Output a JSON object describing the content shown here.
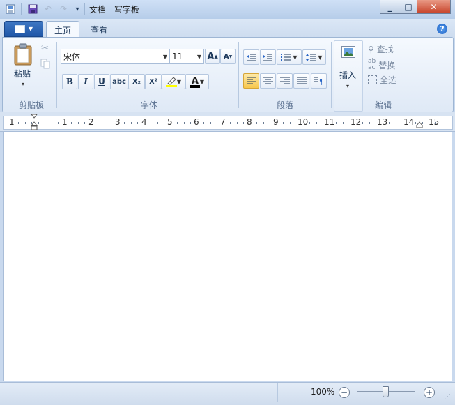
{
  "window": {
    "title": "文档 - 写字板",
    "controls": {
      "minimize": "_",
      "maximize": "□",
      "close": "✕"
    }
  },
  "tabs": [
    {
      "label": "主页"
    },
    {
      "label": "查看"
    }
  ],
  "clipboard": {
    "paste_label": "粘贴",
    "group_label": "剪贴板"
  },
  "font": {
    "family": "宋体",
    "size": "11",
    "group_label": "字体",
    "grow": "A",
    "shrink": "A",
    "bold": "B",
    "italic": "I",
    "underline": "U",
    "strike": "abc",
    "sub": "X₂",
    "sup": "X²",
    "color_letter": "A"
  },
  "paragraph": {
    "group_label": "段落"
  },
  "insert": {
    "label": "插入"
  },
  "editing": {
    "group_label": "编辑",
    "find": "查找",
    "replace": "替换",
    "select_all": "全选"
  },
  "ruler": {
    "numbers": [
      "1",
      "1",
      "2",
      "3",
      "4",
      "5",
      "6",
      "7",
      "8",
      "9",
      "10",
      "11",
      "12",
      "13",
      "14",
      "15"
    ]
  },
  "status": {
    "zoom": "100%",
    "minus": "−",
    "plus": "+"
  },
  "colors": {
    "accent": "#1f57a8",
    "text_color_bar": "#000000",
    "highlight_bar": "#ffff00"
  }
}
